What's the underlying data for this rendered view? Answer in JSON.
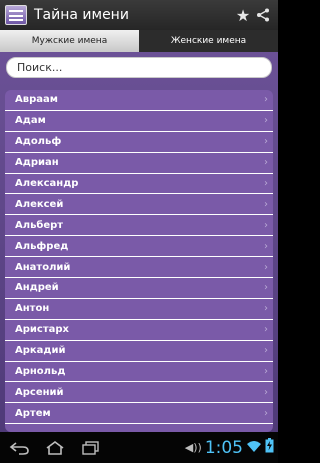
{
  "app": {
    "title": "Тайна имени",
    "logo_text": "Тайна имени"
  },
  "actions": {
    "favorite_icon": "star-icon",
    "share_icon": "share-icon"
  },
  "tabs": [
    {
      "label": "Мужские имена",
      "active": true
    },
    {
      "label": "Женские имена",
      "active": false
    }
  ],
  "search": {
    "placeholder": "Поиск..."
  },
  "names": [
    {
      "label": "Авраам"
    },
    {
      "label": "Адам"
    },
    {
      "label": "Адольф"
    },
    {
      "label": "Адриан"
    },
    {
      "label": "Александр"
    },
    {
      "label": "Алексей"
    },
    {
      "label": "Альберт"
    },
    {
      "label": "Альфред"
    },
    {
      "label": "Анатолий"
    },
    {
      "label": "Андрей"
    },
    {
      "label": "Антон"
    },
    {
      "label": "Аристарх"
    },
    {
      "label": "Аркадий"
    },
    {
      "label": "Арнольд"
    },
    {
      "label": "Арсений"
    },
    {
      "label": "Артем"
    }
  ],
  "status": {
    "time": "1:05",
    "accent_color": "#4fc3f7"
  },
  "colors": {
    "background": "#5b4386",
    "list_bg": "#7a5aa8"
  }
}
